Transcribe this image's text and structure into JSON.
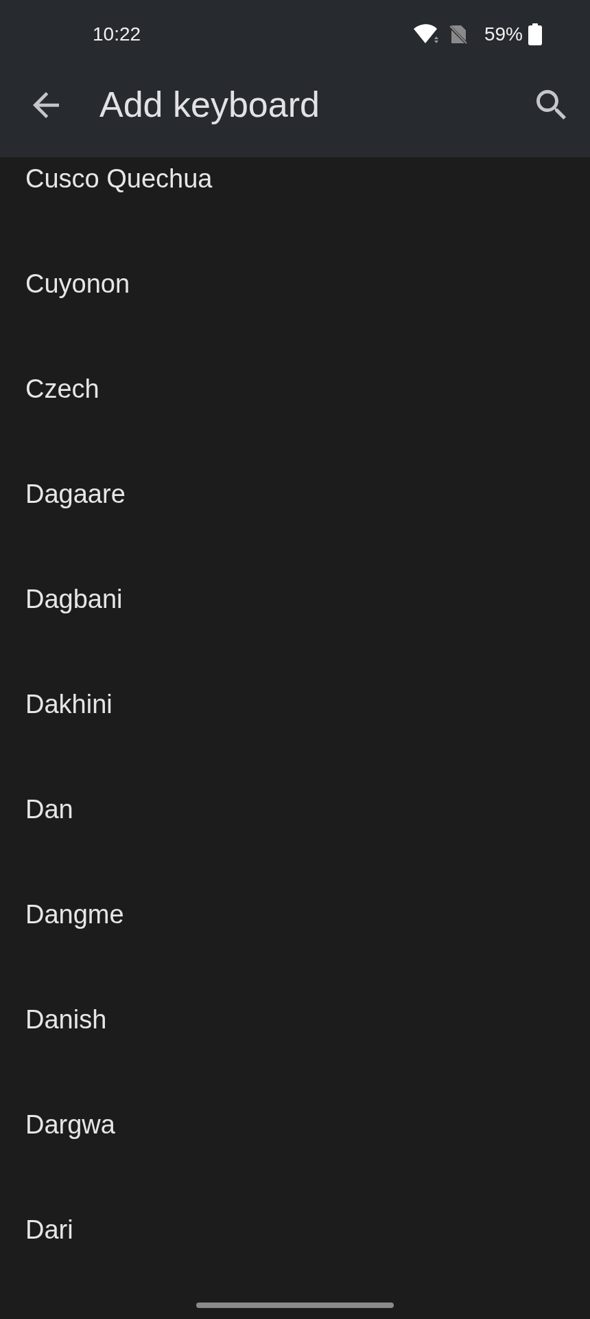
{
  "status_bar": {
    "time": "10:22",
    "battery": "59%"
  },
  "app_bar": {
    "title": "Add keyboard"
  },
  "languages": [
    "Cusco Quechua",
    "Cuyonon",
    "Czech",
    "Dagaare",
    "Dagbani",
    "Dakhini",
    "Dan",
    "Dangme",
    "Danish",
    "Dargwa",
    "Dari"
  ]
}
